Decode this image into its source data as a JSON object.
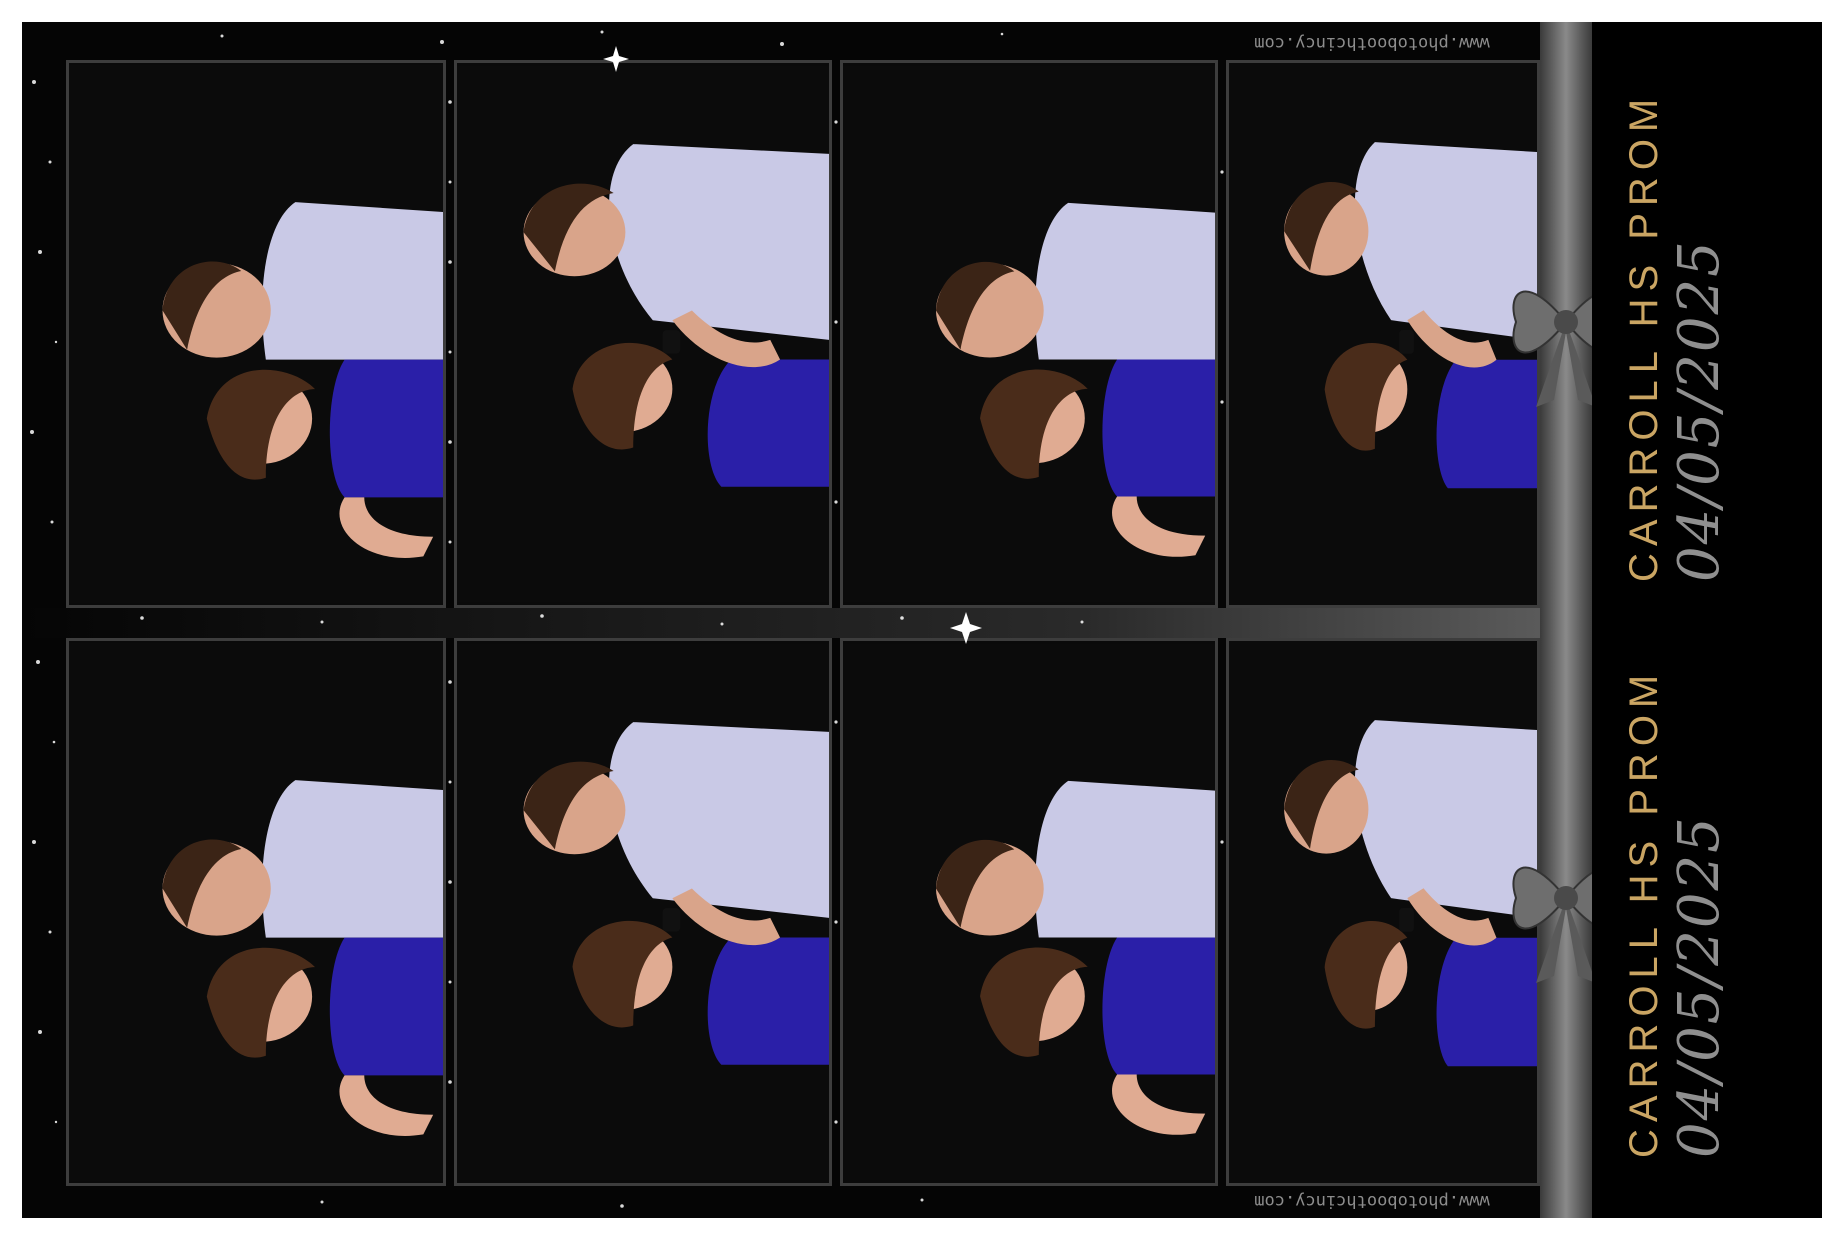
{
  "strips": [
    {
      "title": "CARROLL HS PROM",
      "date": "04/05/2025",
      "website": "www.photoboothcincy.com"
    },
    {
      "title": "CARROLL HS PROM",
      "date": "04/05/2025",
      "website": "www.photoboothcincy.com"
    }
  ],
  "colors": {
    "background": "#050505",
    "title_gold": "#caa563",
    "date_gray": "#8f8f8f",
    "ribbon": "#7a7a7a",
    "shirt": "#c9c9e6",
    "dress": "#2a1fa8",
    "skin": "#d9a48a",
    "hair": "#3b2416"
  },
  "photos": [
    {
      "pose": "couple-smiling"
    },
    {
      "pose": "couple-laughing"
    },
    {
      "pose": "couple-shushing"
    },
    {
      "pose": "couple-hugging"
    },
    {
      "pose": "couple-smiling"
    },
    {
      "pose": "couple-laughing"
    },
    {
      "pose": "couple-shushing"
    },
    {
      "pose": "couple-hugging"
    }
  ]
}
